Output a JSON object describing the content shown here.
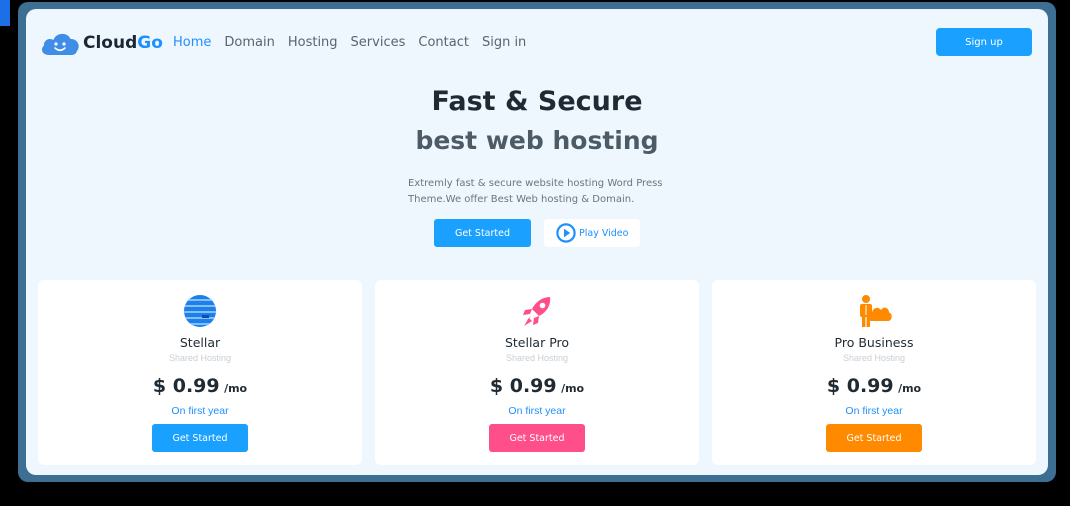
{
  "brand": {
    "name_part1": "Cloud",
    "name_part2": "Go",
    "logo_icon": "smiling-cloud-icon"
  },
  "nav": [
    {
      "label": "Home",
      "active": true
    },
    {
      "label": "Domain",
      "active": false
    },
    {
      "label": "Hosting",
      "active": false
    },
    {
      "label": "Services",
      "active": false
    },
    {
      "label": "Contact",
      "active": false
    },
    {
      "label": "Sign in",
      "active": false
    }
  ],
  "header": {
    "signup_label": "Sign up"
  },
  "hero": {
    "title": "Fast & Secure",
    "subtitle": "best web hosting",
    "desc_line1": "Extremly fast & secure website hosting Word Press",
    "desc_line2": "Theme.We offer Best Web hosting & Domain.",
    "start_label": "Get Started",
    "play_label": "Play Video"
  },
  "plans": [
    {
      "name": "Stellar",
      "type": "Shared Hosting",
      "price": "$ 0.99",
      "period": "/mo",
      "term": "On first year",
      "cta": "Get Started",
      "icon": "globe-stripes-icon",
      "button_color": "#1aa1ff"
    },
    {
      "name": "Stellar Pro",
      "type": "Shared Hosting",
      "price": "$ 0.99",
      "period": "/mo",
      "term": "On first year",
      "cta": "Get Started",
      "icon": "rocket-icon",
      "button_color": "#ff4f8b"
    },
    {
      "name": "Pro Business",
      "type": "Shared Hosting",
      "price": "$ 0.99",
      "period": "/mo",
      "term": "On first year",
      "cta": "Get Started",
      "icon": "person-cloud-icon",
      "button_color": "#ff8a00"
    }
  ],
  "colors": {
    "accent": "#1e90ff",
    "page_bg": "#eef6fe",
    "frame": "#3d6f93"
  }
}
